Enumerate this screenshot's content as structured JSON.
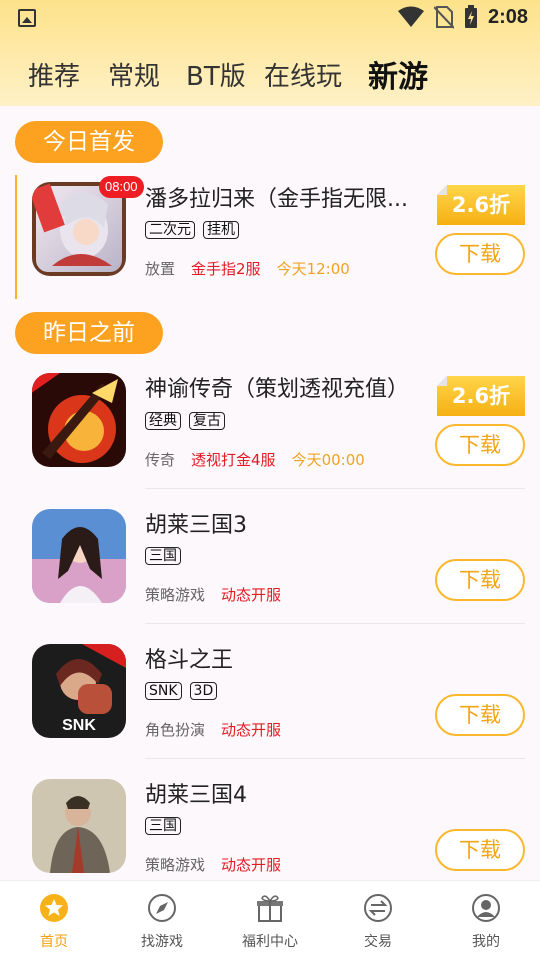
{
  "status_bar": {
    "time": "2:08"
  },
  "tabs": [
    {
      "label": "推荐"
    },
    {
      "label": "常规"
    },
    {
      "label": "BT版"
    },
    {
      "label": "在线玩"
    },
    {
      "label": "新游",
      "active": true
    }
  ],
  "sections": {
    "today": {
      "label": "今日首发"
    },
    "before": {
      "label": "昨日之前"
    }
  },
  "games": [
    {
      "title": "潘多拉归来（金手指无限...",
      "time_badge": "08:00",
      "tags": [
        "二次元",
        "挂机"
      ],
      "category": "放置",
      "server": "金手指2服",
      "open_time": "今天12:00",
      "discount": "2.6折",
      "button": "下载"
    },
    {
      "title": "神谕传奇（策划透视充值）",
      "tags": [
        "经典",
        "复古"
      ],
      "category": "传奇",
      "server": "透视打金4服",
      "open_time": "今天00:00",
      "discount": "2.6折",
      "button": "下载"
    },
    {
      "title": "胡莱三国3",
      "tags": [
        "三国"
      ],
      "category": "策略游戏",
      "server": "动态开服",
      "button": "下载"
    },
    {
      "title": "格斗之王",
      "tags": [
        "SNK",
        "3D"
      ],
      "category": "角色扮演",
      "server": "动态开服",
      "button": "下载"
    },
    {
      "title": "胡莱三国4",
      "tags": [
        "三国"
      ],
      "category": "策略游戏",
      "server": "动态开服",
      "button": "下载"
    }
  ],
  "bottom_nav": [
    {
      "label": "首页",
      "icon": "star-icon",
      "active": true
    },
    {
      "label": "找游戏",
      "icon": "compass-icon"
    },
    {
      "label": "福利中心",
      "icon": "gift-icon"
    },
    {
      "label": "交易",
      "icon": "exchange-icon"
    },
    {
      "label": "我的",
      "icon": "user-icon"
    }
  ],
  "colors": {
    "accent": "#fca120",
    "discount": "#f6b014",
    "red": "#e31b23",
    "header_top": "#fde28a"
  }
}
